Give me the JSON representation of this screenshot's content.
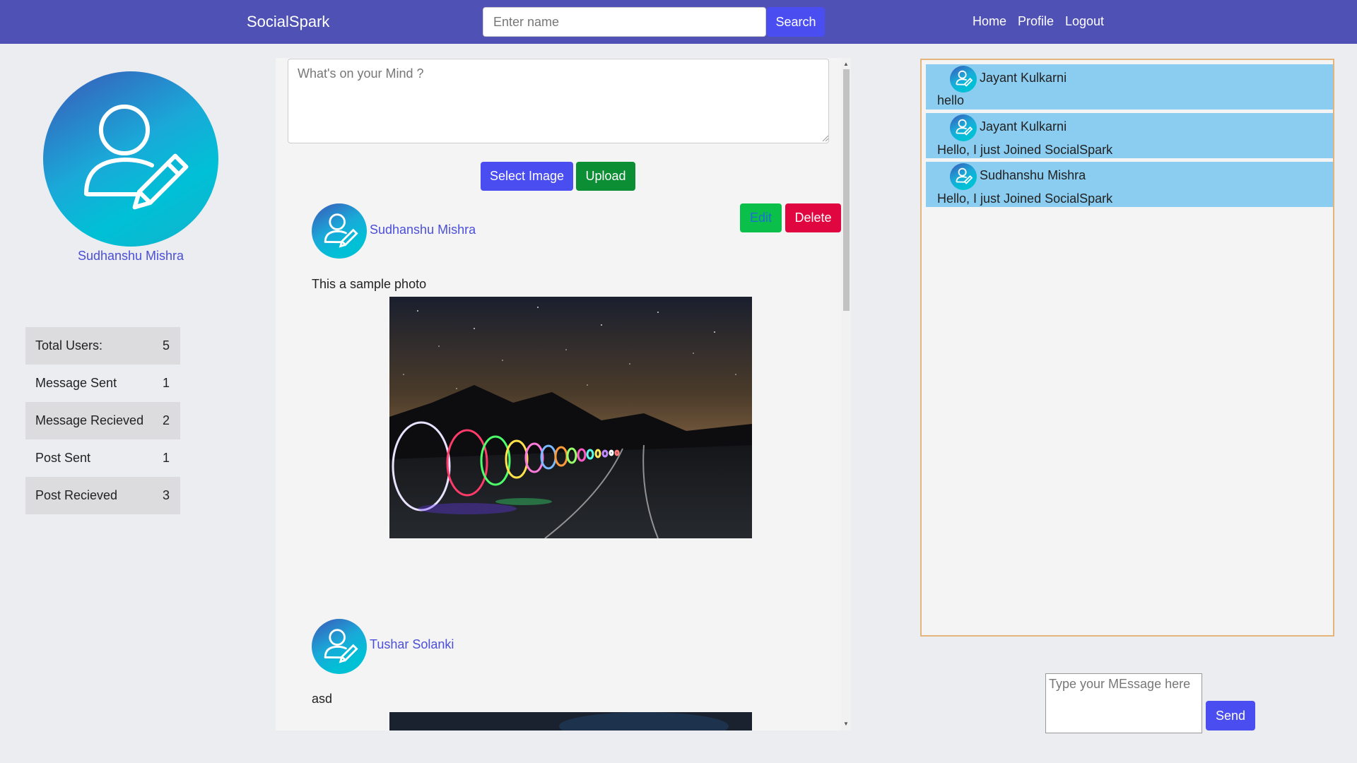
{
  "navbar": {
    "brand": "SocialSpark",
    "search_placeholder": "Enter name",
    "search_label": "Search",
    "links": [
      "Home",
      "Profile",
      "Logout"
    ]
  },
  "profile": {
    "name": "Sudhanshu Mishra"
  },
  "stats": [
    {
      "label": "Total Users:",
      "value": "5"
    },
    {
      "label": "Message Sent",
      "value": "1"
    },
    {
      "label": "Message Recieved",
      "value": "2"
    },
    {
      "label": "Post Sent",
      "value": "1"
    },
    {
      "label": "Post Recieved",
      "value": "3"
    }
  ],
  "composer": {
    "placeholder": "What's on your Mind ?",
    "select_image_label": "Select Image",
    "upload_label": "Upload"
  },
  "posts": [
    {
      "author": "Sudhanshu Mishra",
      "text": "This a sample photo",
      "edit_label": "Edit",
      "delete_label": "Delete"
    },
    {
      "author": "Tushar Solanki",
      "text": "asd"
    }
  ],
  "chat": {
    "messages": [
      {
        "sender": "Jayant Kulkarni",
        "text": "hello"
      },
      {
        "sender": "Jayant Kulkarni",
        "text": "Hello, I just Joined SocialSpark"
      },
      {
        "sender": "Sudhanshu Mishra",
        "text": "Hello, I just Joined SocialSpark"
      }
    ],
    "input_placeholder": "Type your MEssage here",
    "send_label": "Send"
  },
  "colors": {
    "navbar": "#4f51b5",
    "primary_button": "#4a4df0",
    "upload_button": "#0b8e34",
    "edit_button": "#0abf4a",
    "delete_button": "#e0063f",
    "link_text": "#4b4fd8",
    "chat_bubble": "#8bcdf0",
    "chat_border": "#e3b57b"
  }
}
